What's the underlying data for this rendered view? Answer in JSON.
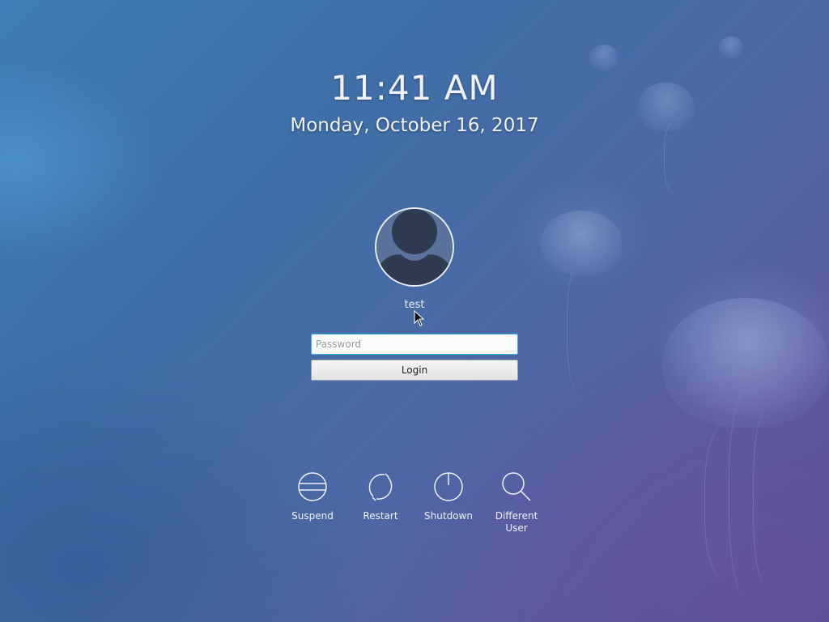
{
  "clock": {
    "time": "11:41 AM",
    "date": "Monday, October 16, 2017"
  },
  "user": {
    "name": "test",
    "avatar_icon": "user-silhouette-icon"
  },
  "login": {
    "password_placeholder": "Password",
    "password_value": "",
    "button_label": "Login"
  },
  "actions": [
    {
      "label": "Suspend",
      "icon": "suspend-icon"
    },
    {
      "label": "Restart",
      "icon": "restart-icon"
    },
    {
      "label": "Shutdown",
      "icon": "shutdown-icon"
    },
    {
      "label": "Different User",
      "icon": "search-icon"
    }
  ],
  "colors": {
    "accent": "#3daee9",
    "text": "#eef2f8",
    "background_blue": "#3f6fa8",
    "background_purple": "#5b4f98"
  }
}
